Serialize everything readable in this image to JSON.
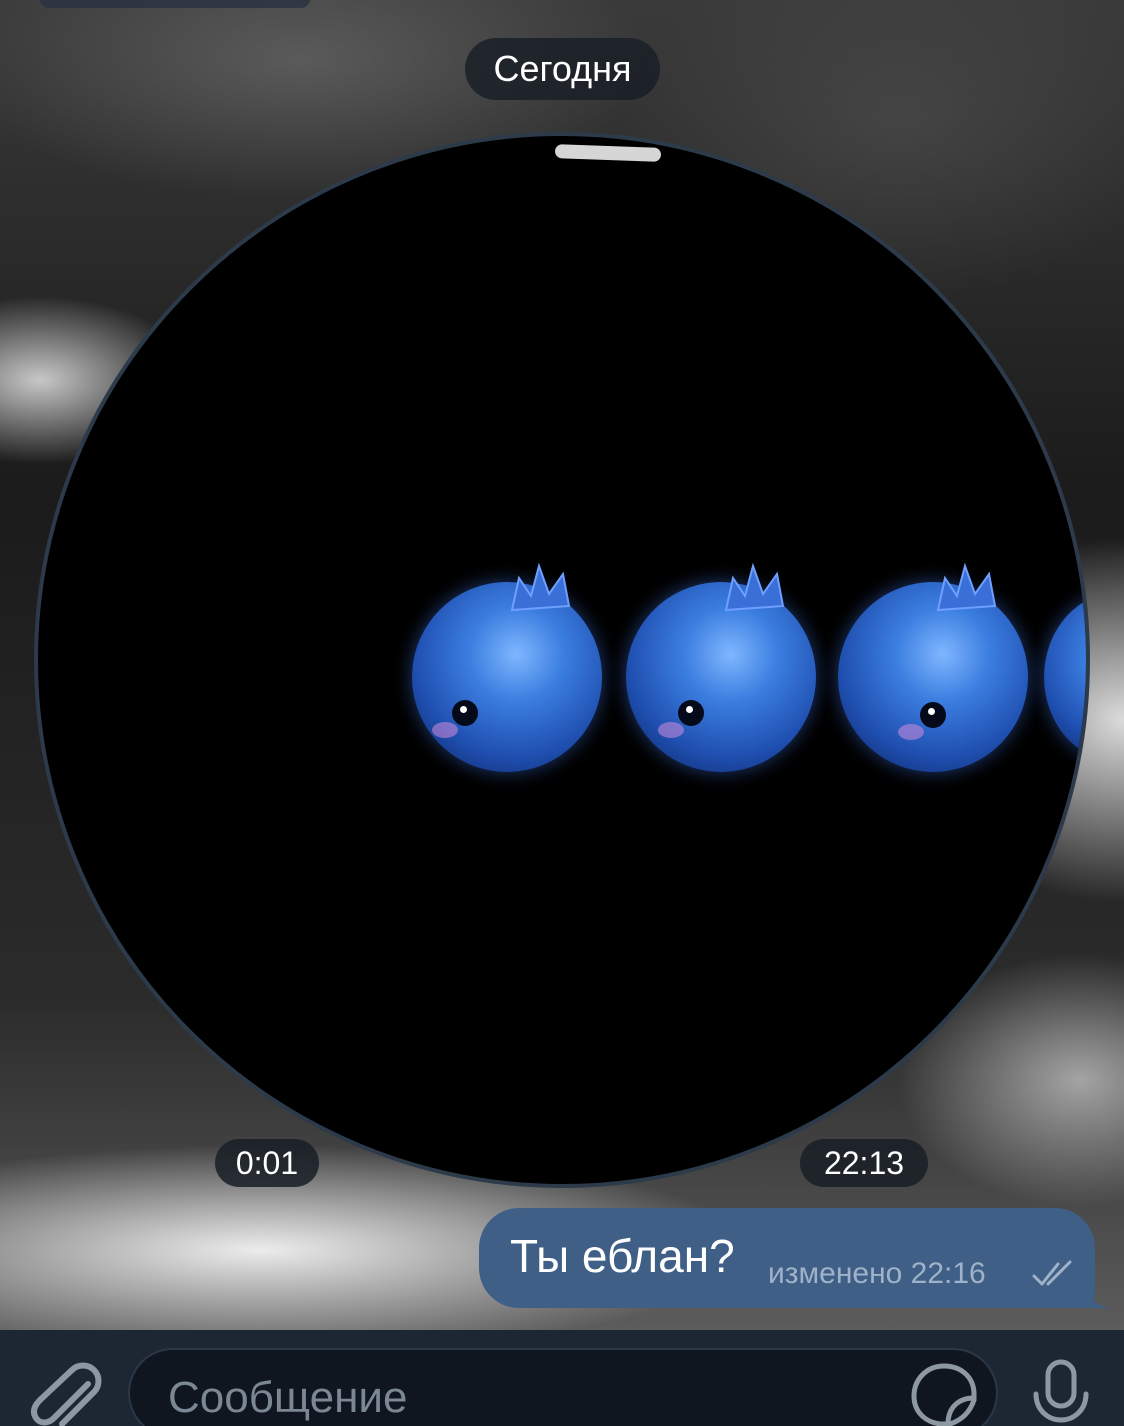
{
  "chat": {
    "date_separator": "Сегодня",
    "video_message": {
      "duration": "0:01",
      "sent_time": "22:13"
    },
    "outgoing_message": {
      "text": "Ты еблан?",
      "edited_label": "изменено",
      "time": "22:16",
      "status_icon": "double-check-icon"
    }
  },
  "composer": {
    "placeholder": "Сообщение",
    "attach_icon": "paperclip-icon",
    "sticker_icon": "sticker-icon",
    "mic_icon": "microphone-icon"
  },
  "colors": {
    "bubble_outgoing": "#3f5f86",
    "input_bar": "#1d2733",
    "pill_bg": "#181e26"
  }
}
